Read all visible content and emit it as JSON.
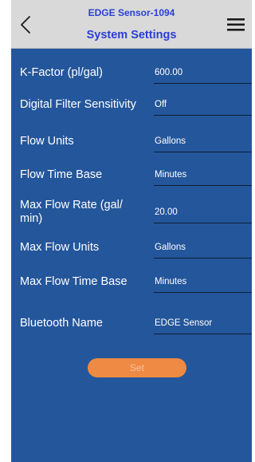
{
  "header": {
    "device_name": "EDGE Sensor-1094",
    "title": "System Settings",
    "back_icon": "chevron-left-icon",
    "menu_icon": "hamburger-menu-icon"
  },
  "settings": [
    {
      "label": "K-Factor (pl/gal)",
      "value": "600.00"
    },
    {
      "label": "Digital Filter Sensitivity",
      "value": "Off"
    },
    {
      "label": "Flow Units",
      "value": "Gallons"
    },
    {
      "label": "Flow Time Base",
      "value": "Minutes"
    },
    {
      "label": "Max Flow Rate (gal/ min)",
      "value": "20.00"
    },
    {
      "label": "Max Flow Units",
      "value": "Gallons"
    },
    {
      "label": "Max Flow Time Base",
      "value": "Minutes"
    },
    {
      "label": "Bluetooth Name",
      "value": "EDGE Sensor"
    }
  ],
  "set_button": {
    "label": "Set"
  },
  "colors": {
    "header_bg": "#d9d9d9",
    "header_text": "#2a3fd6",
    "body_bg": "#24569b",
    "button_bg": "#ee8a43",
    "button_text": "#f7c39f"
  }
}
